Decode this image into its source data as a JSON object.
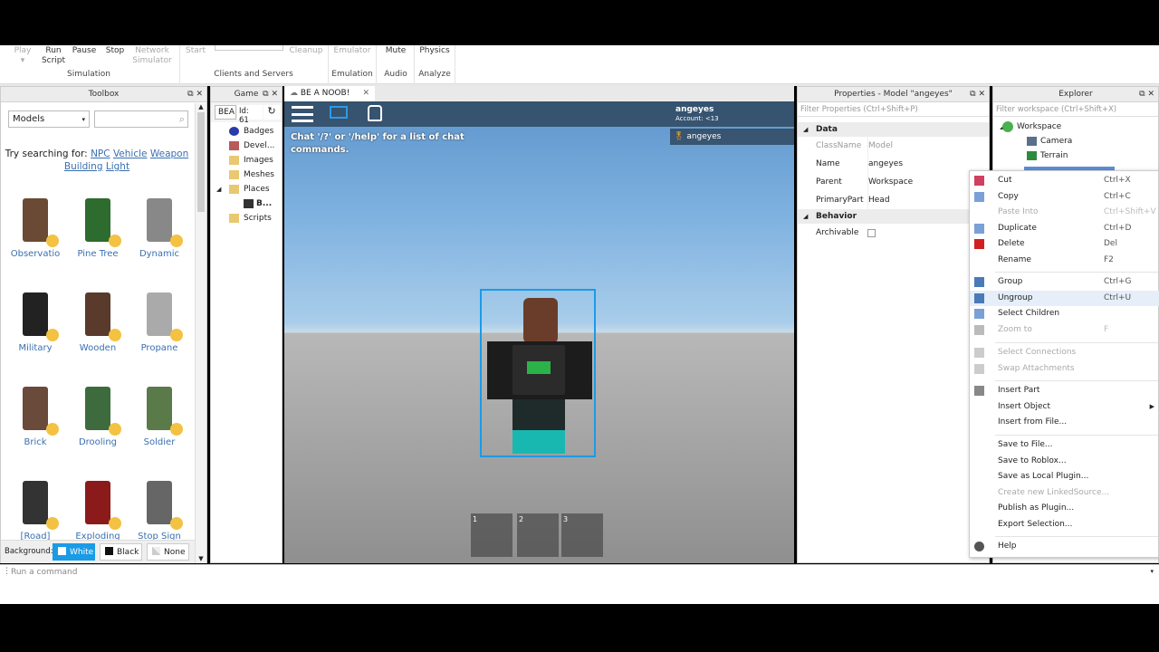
{
  "ribbon": {
    "play": "Play",
    "run_script": "Run Script",
    "pause": "Pause",
    "stop": "Stop",
    "network_simulator": "Network Simulator",
    "simulation": "Simulation",
    "start": "Start",
    "cleanup": "Cleanup",
    "clients_and_servers": "Clients and Servers",
    "emulator": "Emulator",
    "emulation": "Emulation",
    "mute": "Mute",
    "audio": "Audio",
    "physics": "Physics",
    "analyze": "Analyze"
  },
  "toolbox": {
    "title": "Toolbox",
    "category": "Models",
    "search_placeholder": "",
    "try_searching": "Try searching for:",
    "suggestions": [
      "NPC",
      "Vehicle",
      "Weapon",
      "Building",
      "Light"
    ],
    "items": [
      "Observatio",
      "Pine Tree",
      "Dynamic",
      "Military",
      "Wooden",
      "Propane",
      "Brick",
      "Drooling",
      "Soldier",
      "[Road]",
      "Exploding",
      "Stop Sign"
    ],
    "background_label": "Background:",
    "bg_white": "White",
    "bg_black": "Black",
    "bg_none": "None"
  },
  "game": {
    "title": "Game",
    "name_field": "BEA",
    "id_field": "Id: 61",
    "items": [
      "Badges",
      "Devel...",
      "Images",
      "Meshes",
      "Places",
      "B...",
      "Scripts"
    ]
  },
  "viewport": {
    "tab": "BE A NOOB!",
    "chat_hint": "Chat '/?' or '/help' for a list of chat commands.",
    "username": "angeyes",
    "account": "Account: <13",
    "player": "angeyes",
    "hotbar": [
      "1",
      "2",
      "3"
    ]
  },
  "properties": {
    "title": "Properties - Model \"angeyes\"",
    "filter": "Filter Properties (Ctrl+Shift+P)",
    "data": "Data",
    "behavior": "Behavior",
    "rows": [
      {
        "k": "ClassName",
        "v": "Model"
      },
      {
        "k": "Name",
        "v": "angeyes"
      },
      {
        "k": "Parent",
        "v": "Workspace"
      },
      {
        "k": "PrimaryPart",
        "v": "Head"
      }
    ],
    "archivable": "Archivable"
  },
  "explorer": {
    "title": "Explorer",
    "filter": "Filter workspace (Ctrl+Shift+X)",
    "items": [
      "Workspace",
      "Camera",
      "Terrain"
    ]
  },
  "context_menu": [
    {
      "l": "Cut",
      "k": "Ctrl+X"
    },
    {
      "l": "Copy",
      "k": "Ctrl+C"
    },
    {
      "l": "Paste Into",
      "k": "Ctrl+Shift+V",
      "dis": true
    },
    {
      "l": "Duplicate",
      "k": "Ctrl+D"
    },
    {
      "l": "Delete",
      "k": "Del"
    },
    {
      "l": "Rename",
      "k": "F2"
    },
    {
      "l": "Group",
      "k": "Ctrl+G"
    },
    {
      "l": "Ungroup",
      "k": "Ctrl+U"
    },
    {
      "l": "Select Children",
      "k": ""
    },
    {
      "l": "Zoom to",
      "k": "F",
      "dis": true
    },
    {
      "l": "Select Connections",
      "k": "",
      "dis": true
    },
    {
      "l": "Swap Attachments",
      "k": "",
      "dis": true
    },
    {
      "l": "Insert Part",
      "k": ""
    },
    {
      "l": "Insert Object",
      "k": ""
    },
    {
      "l": "Insert from File...",
      "k": ""
    },
    {
      "l": "Save to File...",
      "k": ""
    },
    {
      "l": "Save to Roblox...",
      "k": ""
    },
    {
      "l": "Save as Local Plugin...",
      "k": ""
    },
    {
      "l": "Create new LinkedSource...",
      "k": "",
      "dis": true
    },
    {
      "l": "Publish as Plugin...",
      "k": ""
    },
    {
      "l": "Export Selection...",
      "k": ""
    },
    {
      "l": "Help",
      "k": ""
    }
  ],
  "command_bar": {
    "placeholder": "Run a command"
  },
  "colors": {
    "accent": "#1a9be6",
    "selection": "#c9e0f7"
  }
}
